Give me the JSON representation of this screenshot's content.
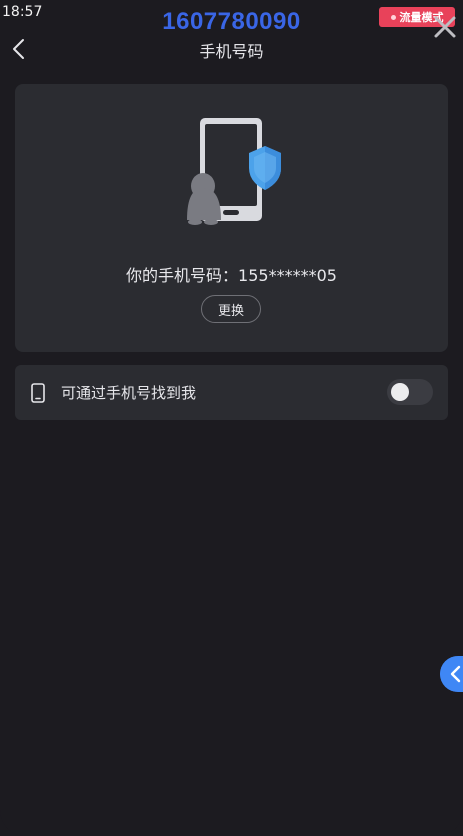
{
  "status_bar": {
    "time": "18:57"
  },
  "overlay": {
    "number": "1607780090",
    "record_badge": "流量模式",
    "close_icon": "close-icon"
  },
  "header": {
    "title": "手机号码",
    "back_icon": "chevron-left-icon"
  },
  "card": {
    "illustration_icon": "phone-shield-illustration",
    "phone_text": "你的手机号码：155******05",
    "change_button": "更换"
  },
  "setting": {
    "icon": "phone-outline-icon",
    "label": "可通过手机号找到我",
    "toggle_on": false
  },
  "side_tab": {
    "icon": "chevron-left-icon",
    "color": "#3f87f5"
  },
  "colors": {
    "background": "#1c1b20",
    "card": "#2b2c31",
    "accent_number": "#3a66e6",
    "badge": "#e8425a",
    "shield": "#4ca2ea"
  }
}
